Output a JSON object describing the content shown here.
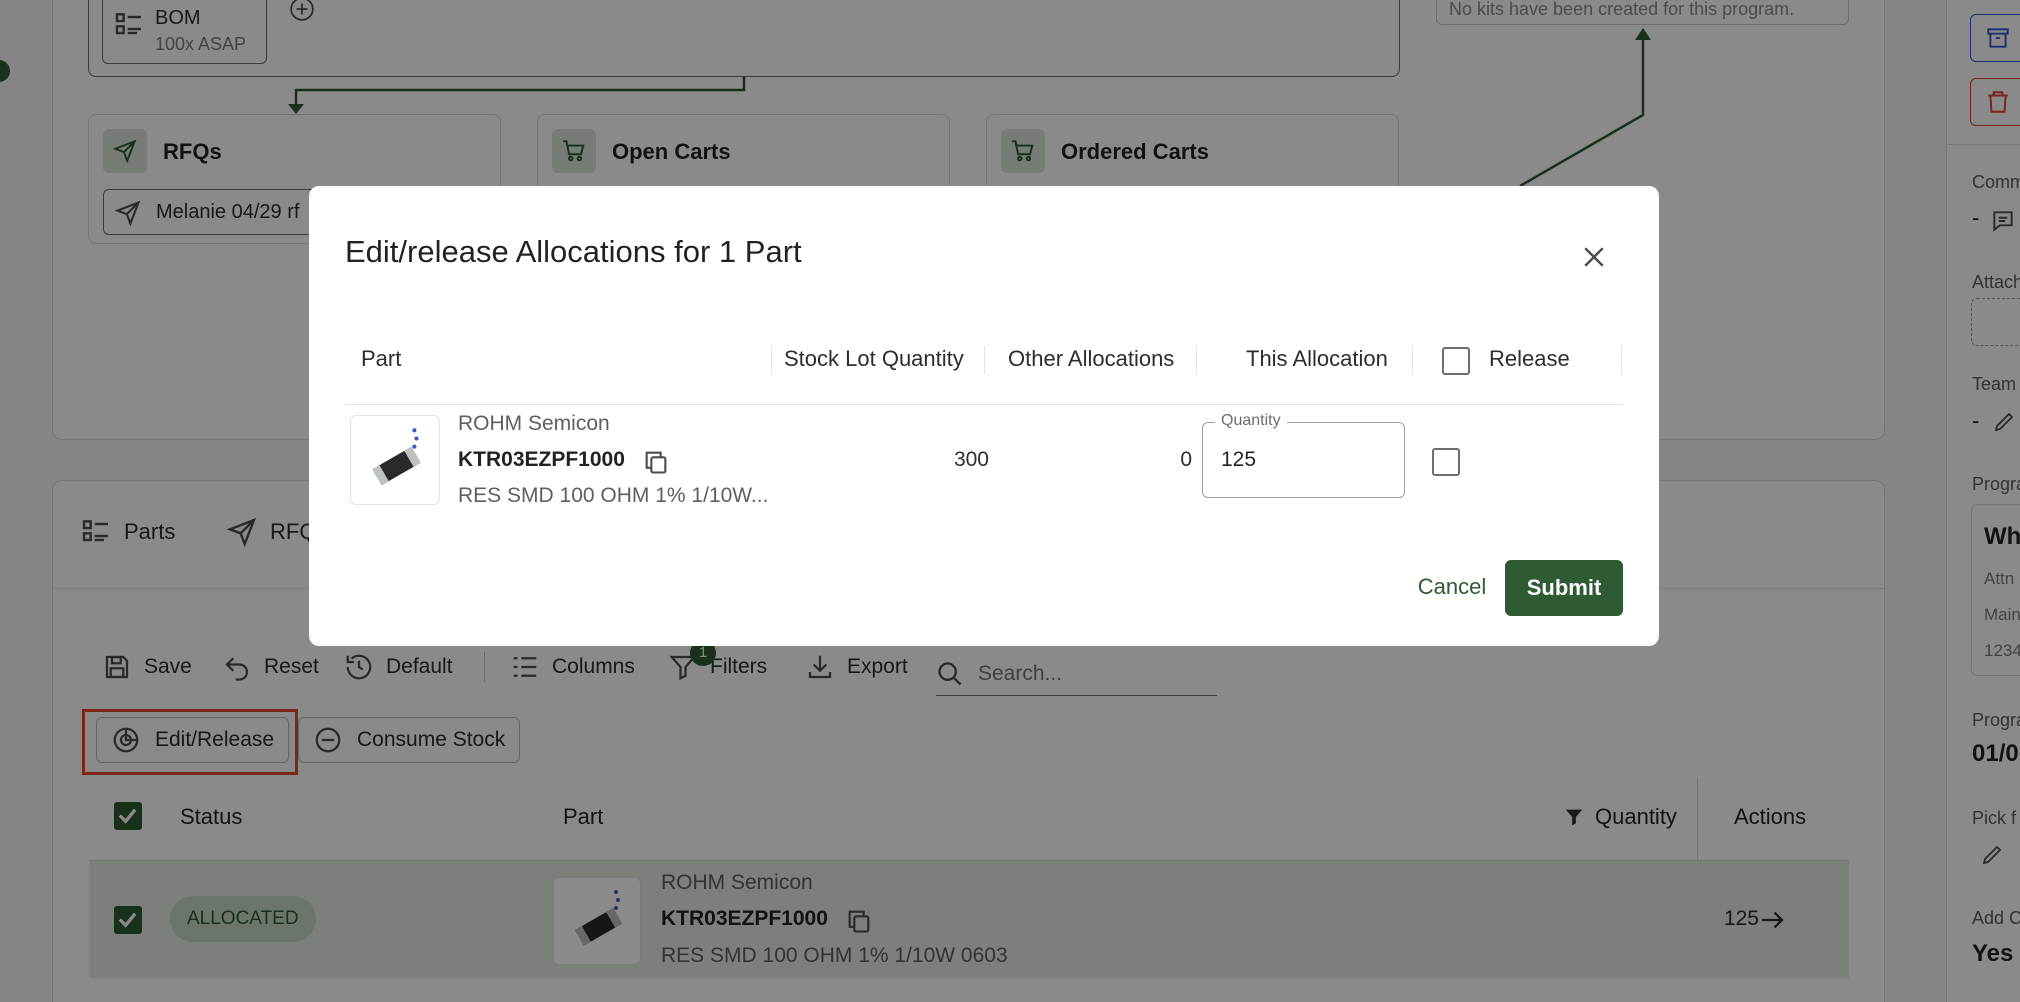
{
  "flow": {
    "bom_label": "BOM",
    "bom_sub": "100x ASAP",
    "rfqs_label": "RFQs",
    "rfq_chip": "Melanie 04/29 rf",
    "open_carts_label": "Open Carts",
    "ordered_carts_label": "Ordered Carts",
    "kits_empty": "No kits have been created for this program."
  },
  "tabs": {
    "parts": "Parts",
    "rfq": "RFQ"
  },
  "toolbar": {
    "save": "Save",
    "reset": "Reset",
    "default": "Default",
    "columns": "Columns",
    "filters": "Filters",
    "filters_badge": "1",
    "export": "Export",
    "search_placeholder": "Search..."
  },
  "actions": {
    "edit_release": "Edit/Release",
    "consume_stock": "Consume Stock"
  },
  "table": {
    "headers": {
      "status": "Status",
      "part": "Part",
      "quantity": "Quantity",
      "actions": "Actions"
    },
    "row": {
      "status": "ALLOCATED",
      "manufacturer": "ROHM Semicon",
      "part_number": "KTR03EZPF1000",
      "description": "RES SMD 100 OHM 1% 1/10W 0603",
      "quantity": "125"
    }
  },
  "sidebar": {
    "comm_label": "Comm",
    "comm_value": "-",
    "attach_label": "Attach",
    "team_label": "Team",
    "team_value": "-",
    "program_label": "Progra",
    "program_box_title": "Wh",
    "program_box_l1": "Attn",
    "program_box_l2": "Main",
    "program_box_l3": "1234",
    "program_date_label": "Progra",
    "program_date_value": "01/0",
    "pick_label": "Pick f",
    "add_label": "Add C",
    "add_value": "Yes"
  },
  "modal": {
    "title": "Edit/release Allocations for 1 Part",
    "headers": {
      "part": "Part",
      "stock_lot_qty": "Stock Lot Quantity",
      "other_alloc": "Other Allocations",
      "this_alloc": "This Allocation",
      "release": "Release"
    },
    "row": {
      "manufacturer": "ROHM Semicon",
      "part_number": "KTR03EZPF1000",
      "description": "RES SMD 100 OHM 1% 1/10W...",
      "stock_lot_qty": "300",
      "other_alloc": "0",
      "qty_label": "Quantity",
      "qty_value": "125"
    },
    "cancel": "Cancel",
    "submit": "Submit"
  },
  "colors": {
    "accent": "#2e5a34",
    "highlight": "#e8472b"
  }
}
